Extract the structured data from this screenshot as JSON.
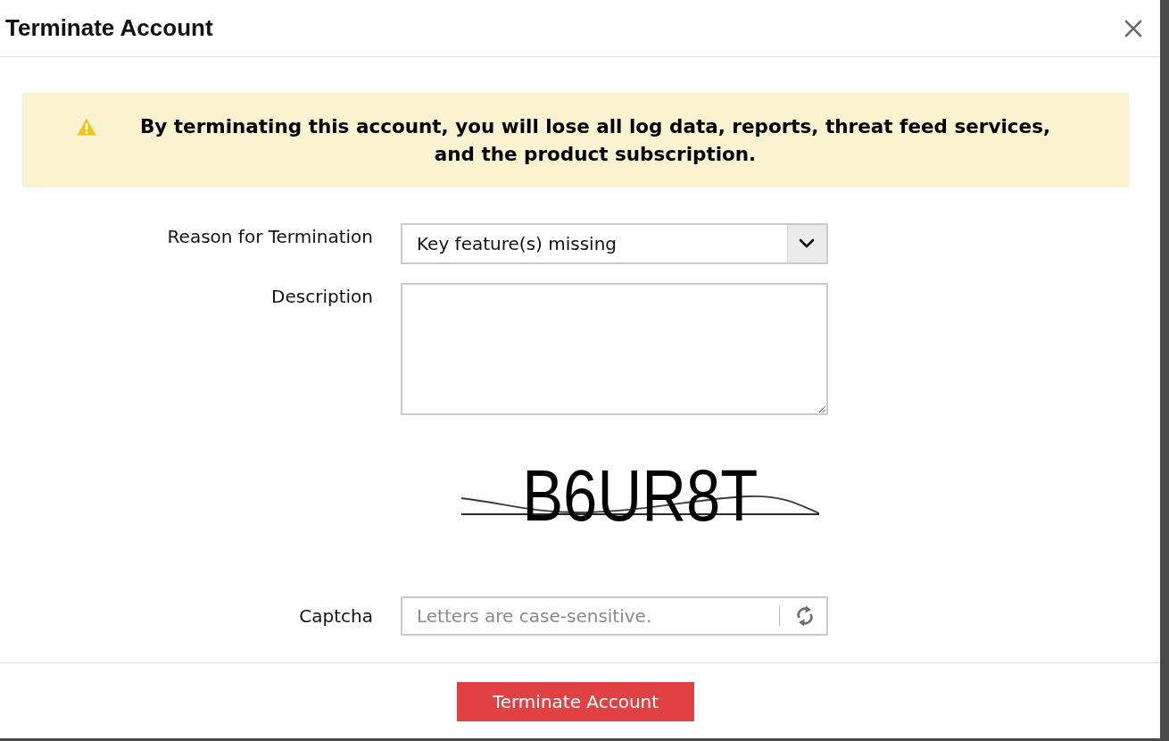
{
  "dialog": {
    "title": "Terminate Account"
  },
  "warning": {
    "text": "By terminating this account, you will lose all log data, reports, threat feed services, and the product subscription."
  },
  "form": {
    "fields": [
      {
        "kind": "select",
        "label": "Reason for Termination",
        "value": "Key feature(s) missing"
      },
      {
        "kind": "textarea",
        "label": "Description"
      },
      {
        "kind": "captcha_image",
        "text": "B6UR8T"
      },
      {
        "kind": "captcha_input",
        "label": "Captcha",
        "placeholder": "Letters are case-sensitive."
      }
    ]
  },
  "submit_button": {
    "label": "Terminate Account"
  }
}
